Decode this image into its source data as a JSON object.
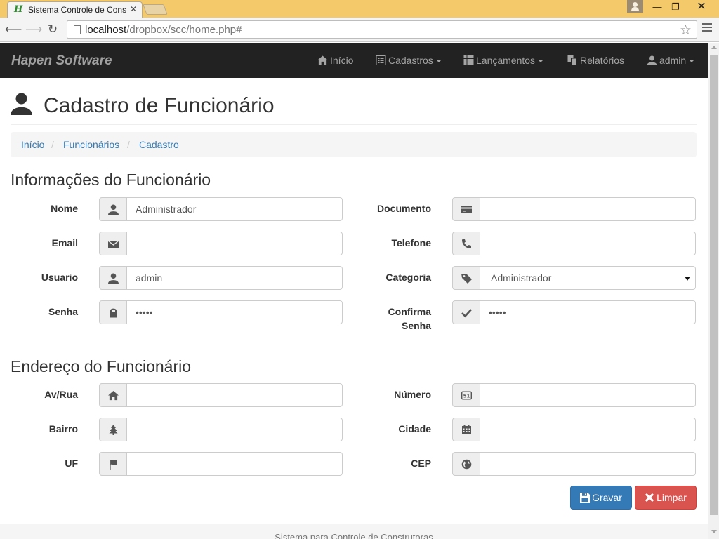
{
  "browser": {
    "tab_title": "Sistema Controle de Cons",
    "tab_favicon": "H",
    "url_host": "localhost",
    "url_path": "/dropbox/scc/home.php#"
  },
  "navbar": {
    "brand": "Hapen Software",
    "items": [
      {
        "label": "Início",
        "icon": "home-icon"
      },
      {
        "label": "Cadastros",
        "icon": "list-alt-icon",
        "dropdown": true
      },
      {
        "label": "Lançamentos",
        "icon": "th-list-icon",
        "dropdown": true
      },
      {
        "label": "Relatórios",
        "icon": "duplicate-icon"
      },
      {
        "label": "admin",
        "icon": "user-icon",
        "dropdown": true
      }
    ]
  },
  "page": {
    "title": "Cadastro de Funcionário",
    "breadcrumb": [
      "Início",
      "Funcionários",
      "Cadastro"
    ],
    "breadcrumb_separator": "/"
  },
  "section_info": {
    "title": "Informações do Funcionário",
    "fields": {
      "nome": {
        "label": "Nome",
        "value": "Administrador",
        "icon": "user-icon"
      },
      "documento": {
        "label": "Documento",
        "value": "",
        "icon": "credit-card-icon"
      },
      "email": {
        "label": "Email",
        "value": "",
        "icon": "envelope-icon"
      },
      "telefone": {
        "label": "Telefone",
        "value": "",
        "icon": "phone-icon"
      },
      "usuario": {
        "label": "Usuario",
        "value": "admin",
        "icon": "user-icon"
      },
      "categoria": {
        "label": "Categoria",
        "value": "Administrador",
        "icon": "tag-icon"
      },
      "senha": {
        "label": "Senha",
        "value": "•••••",
        "icon": "lock-icon"
      },
      "confirma_senha": {
        "label_line1": "Confirma",
        "label_line2": "Senha",
        "value": "•••••",
        "icon": "ok-icon"
      }
    }
  },
  "section_address": {
    "title": "Endereço do Funcionário",
    "fields": {
      "rua": {
        "label": "Av/Rua",
        "value": "",
        "icon": "home-icon"
      },
      "numero": {
        "label": "Número",
        "value": "",
        "icon": "sound-5-1-icon"
      },
      "bairro": {
        "label": "Bairro",
        "value": "",
        "icon": "tree-icon"
      },
      "cidade": {
        "label": "Cidade",
        "value": "",
        "icon": "calendar-icon"
      },
      "uf": {
        "label": "UF",
        "value": "",
        "icon": "flag-icon"
      },
      "cep": {
        "label": "CEP",
        "value": "",
        "icon": "globe-icon"
      }
    }
  },
  "actions": {
    "save_label": "Gravar",
    "clear_label": "Limpar"
  },
  "footer": {
    "text": "Sistema para Controle de Construtoras"
  },
  "colors": {
    "navbar_bg": "#222222",
    "primary": "#337ab7",
    "danger": "#d9534f",
    "link": "#337ab7"
  }
}
